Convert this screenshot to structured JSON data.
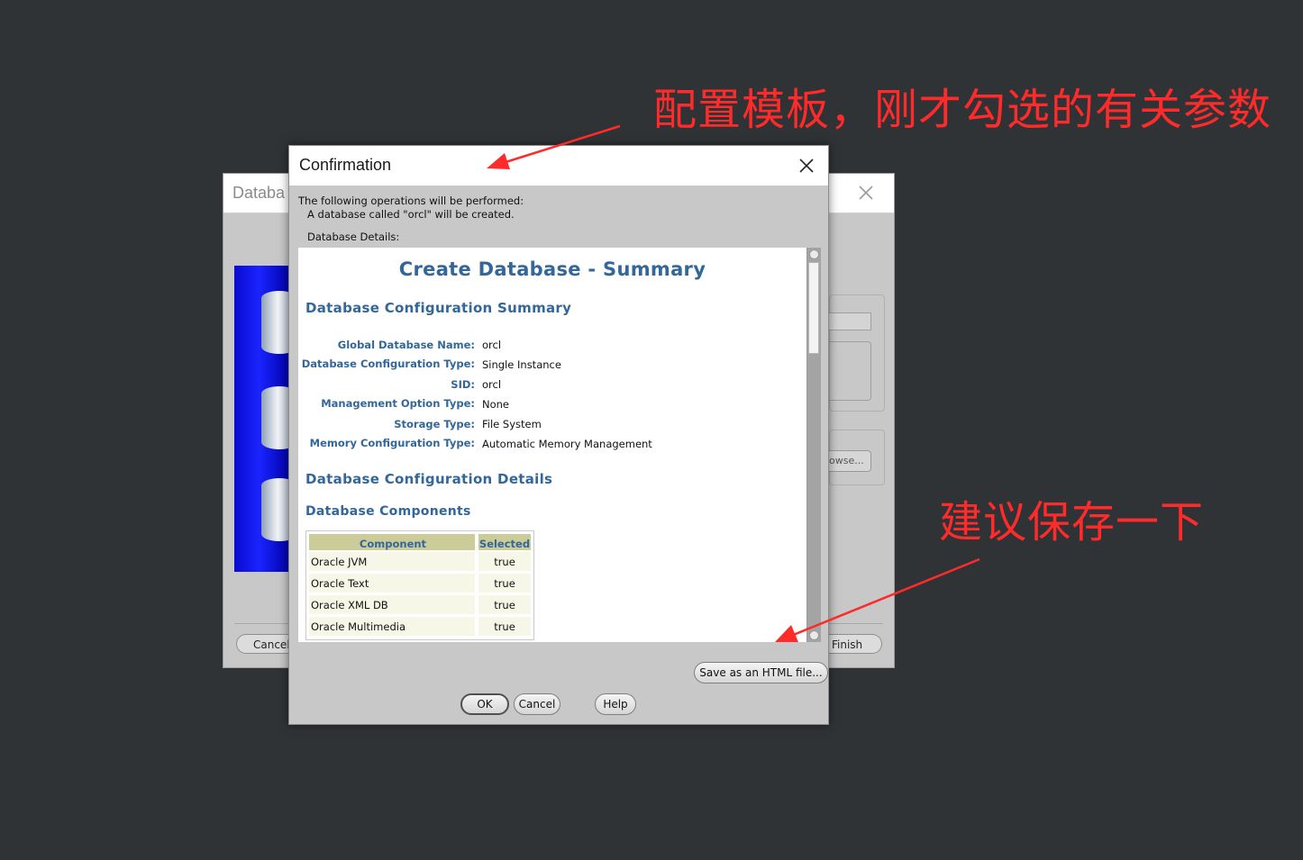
{
  "background_window": {
    "title": "Databa",
    "browse_label": "owse...",
    "cancel_label": "Cancel",
    "finish_label": "Finish"
  },
  "dialog": {
    "title": "Confirmation",
    "intro": "The following operations will be performed:",
    "created_msg": "A database called \"orcl\" will be created.",
    "details_label": "Database Details:",
    "summary": {
      "title": "Create Database - Summary",
      "config_summary_heading": "Database Configuration Summary",
      "fields": [
        {
          "label": "Global Database Name:",
          "value": "orcl"
        },
        {
          "label": "Database Configuration Type:",
          "value": "Single Instance"
        },
        {
          "label": "SID:",
          "value": "orcl"
        },
        {
          "label": "Management Option Type:",
          "value": "None"
        },
        {
          "label": "Storage Type:",
          "value": "File System"
        },
        {
          "label": "Memory Configuration Type:",
          "value": "Automatic Memory Management"
        }
      ],
      "config_details_heading": "Database Configuration Details",
      "components_heading": "Database Components",
      "components_table": {
        "headers": [
          "Component",
          "Selected"
        ],
        "rows": [
          [
            "Oracle JVM",
            "true"
          ],
          [
            "Oracle Text",
            "true"
          ],
          [
            "Oracle XML DB",
            "true"
          ],
          [
            "Oracle Multimedia",
            "true"
          ]
        ]
      }
    },
    "buttons": {
      "save_html": "Save as an HTML file...",
      "ok": "OK",
      "cancel": "Cancel",
      "help": "Help"
    }
  },
  "annotations": {
    "template_note": "配置模板，刚才勾选的有关参数",
    "save_note": "建议保存一下",
    "color": "#ff2a2a"
  }
}
